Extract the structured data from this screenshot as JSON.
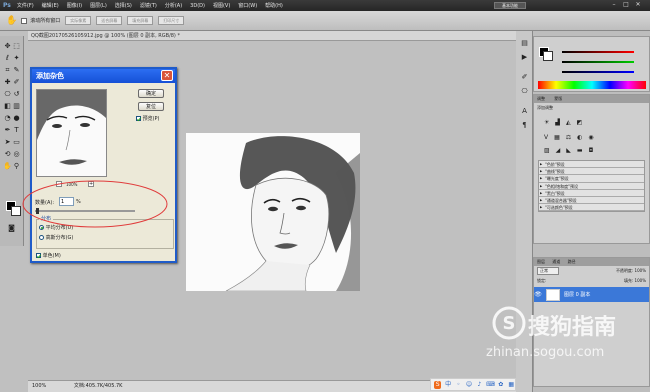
{
  "menubar": {
    "app_logo": "Ps",
    "items": [
      "文件(F)",
      "编辑(E)",
      "图像(I)",
      "图层(L)",
      "选择(S)",
      "滤镜(T)",
      "分析(A)",
      "3D(D)",
      "视图(V)",
      "窗口(W)",
      "帮助(H)"
    ],
    "workspace": "基本功能",
    "min": "–",
    "max": "□",
    "close": "✕"
  },
  "options": {
    "scroll_all_windows": "滚动所有窗口",
    "actual_pixels": "实际像素",
    "fit_screen": "适合屏幕",
    "fill_screen": "填充屏幕",
    "print_size": "打印尺寸"
  },
  "document": {
    "tab_title": "QQ截图20170526105912.jpg @ 100% (图层 0 副本, RGB/8) *",
    "zoom": "100%",
    "doc_size": "文档:405.7K/405.7K"
  },
  "dialog": {
    "title": "添加杂色",
    "ok": "确定",
    "reset": "复位",
    "preview_label": "预览(P)",
    "preview_checked": true,
    "preview_zoom": "100%",
    "zoom_out": "–",
    "zoom_in": "+",
    "amount_label": "数量(A):",
    "amount_value": "1",
    "amount_unit": "%",
    "amount_fraction": 0.01,
    "distribution_label": "分布",
    "uniform": "平均分布(U)",
    "gaussian": "高斯分布(G)",
    "uniform_selected": true,
    "mono": "单色(M)",
    "mono_checked": true,
    "close": "✕"
  },
  "right_panels": {
    "adjust_tabs": [
      "调整",
      "蒙版"
    ],
    "adjust_subtitle": "添加调整",
    "presets": [
      "\"色阶\"预设",
      "\"曲线\"预设",
      "\"曝光度\"预设",
      "\"色相/饱和度\"预设",
      "\"黑白\"预设",
      "\"通道混合器\"预设",
      "\"可选颜色\"预设"
    ],
    "layer_tabs": [
      "图层",
      "通道",
      "路径"
    ],
    "blend_mode": "正常",
    "opacity": "不透明度: 100%",
    "lock": "锁定:",
    "fill": "填充: 100%",
    "layer_name": "图层 0 副本"
  },
  "watermark": {
    "brand": "搜狗指南",
    "url": "zhinan.sogou.com"
  },
  "colors": {
    "accent_blue": "#1f5bc9",
    "selected_layer": "#3b78d8",
    "red_highlight": "#e03a3a"
  }
}
